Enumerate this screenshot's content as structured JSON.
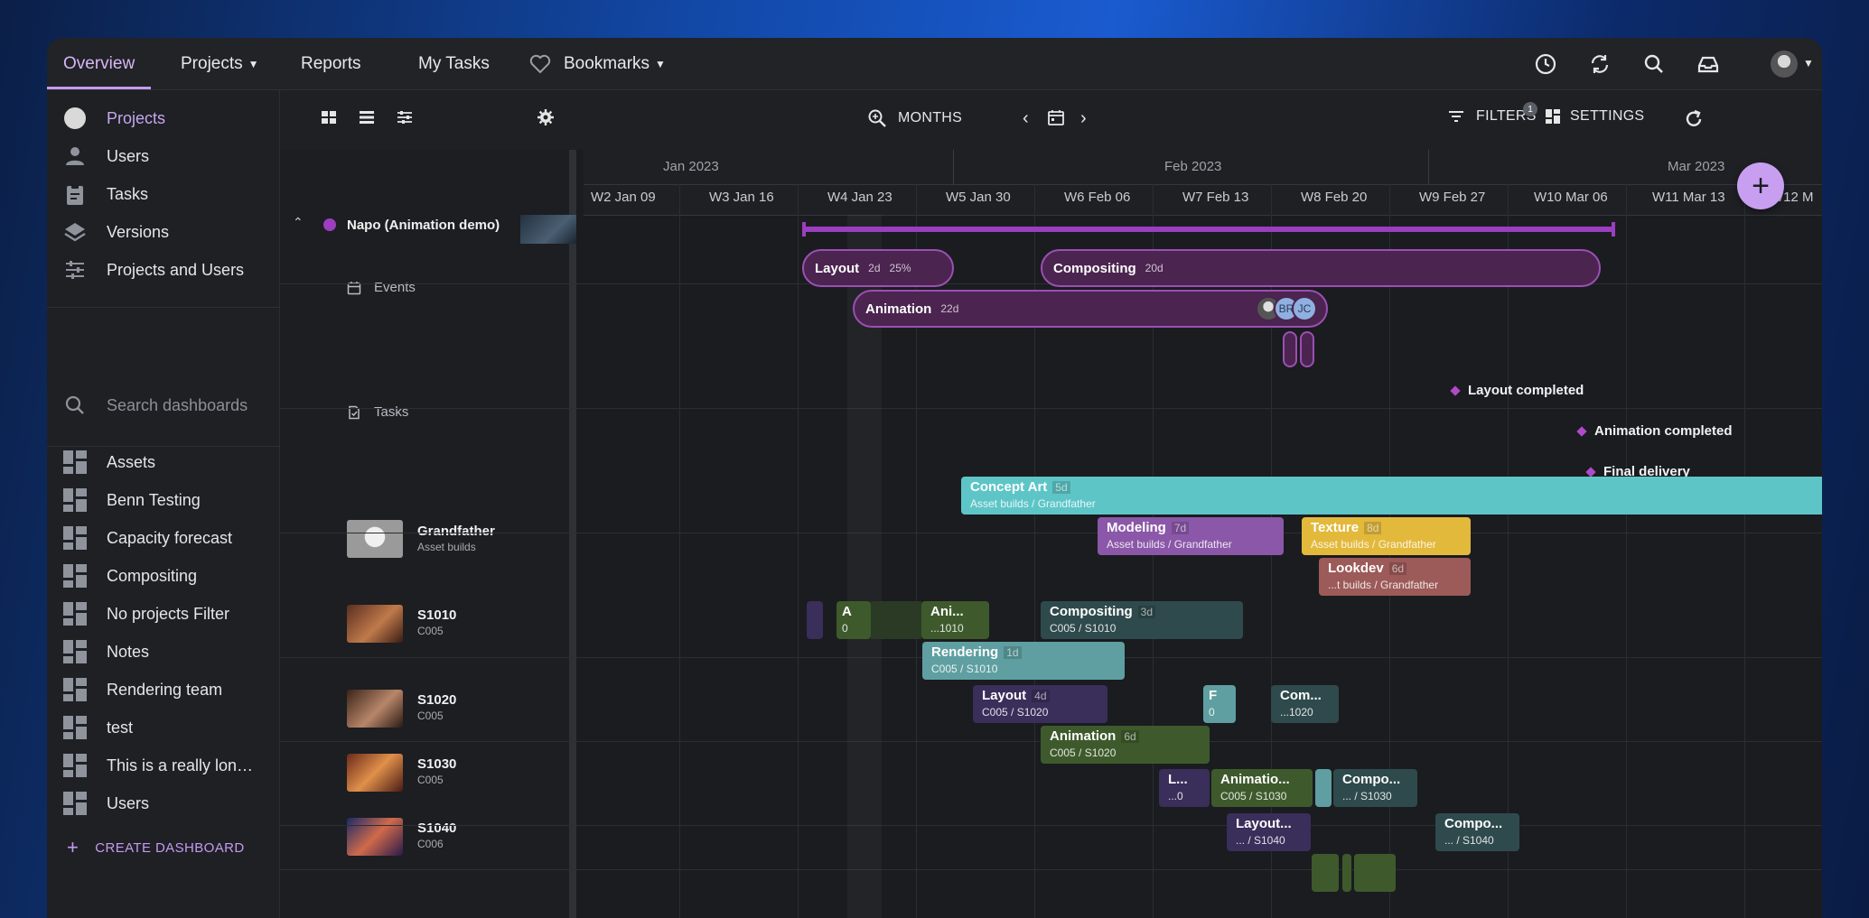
{
  "nav": {
    "overview": "Overview",
    "projects": "Projects",
    "reports": "Reports",
    "my_tasks": "My Tasks",
    "bookmarks": "Bookmarks"
  },
  "sidebar": {
    "items": [
      {
        "label": "Projects"
      },
      {
        "label": "Users"
      },
      {
        "label": "Tasks"
      },
      {
        "label": "Versions"
      },
      {
        "label": "Projects and Users"
      }
    ],
    "search_placeholder": "Search dashboards",
    "dashboards": [
      "Assets",
      "Benn Testing",
      "Capacity forecast",
      "Compositing",
      "No projects Filter",
      "Notes",
      "Rendering team",
      "test",
      "This is a really lon…",
      "Users"
    ],
    "create_label": "CREATE DASHBOARD"
  },
  "toolbar": {
    "zoom_label": "MONTHS",
    "filters_label": "FILTERS",
    "filters_count": "1",
    "settings_label": "SETTINGS"
  },
  "timeline": {
    "months": [
      "Jan 2023",
      "Feb 2023",
      "Mar 2023"
    ],
    "weeks": [
      "W2 Jan 09",
      "W3 Jan 16",
      "W4 Jan 23",
      "W5 Jan 30",
      "W6 Feb 06",
      "W7 Feb 13",
      "W8 Feb 20",
      "W9 Feb 27",
      "W10 Mar 06",
      "W11 Mar 13",
      "W12 M"
    ]
  },
  "rows": {
    "project": "Napo (Animation demo)",
    "events": "Events",
    "tasks": "Tasks",
    "grandfather": {
      "title": "Grandfather",
      "sub": "Asset builds"
    },
    "s1010": {
      "title": "S1010",
      "sub": "C005"
    },
    "s1020": {
      "title": "S1020",
      "sub": "C005"
    },
    "s1030": {
      "title": "S1030",
      "sub": "C005"
    },
    "s1040": {
      "title": "S1040",
      "sub": "C006"
    }
  },
  "events": {
    "layout": {
      "title": "Layout",
      "dur": "2d",
      "pct": "25%"
    },
    "compositing": {
      "title": "Compositing",
      "dur": "20d"
    },
    "animation": {
      "title": "Animation",
      "dur": "22d",
      "avatars": [
        "BR",
        "JC"
      ]
    }
  },
  "milestones": [
    "Layout completed",
    "Animation completed",
    "Final delivery"
  ],
  "bars": {
    "concept_art": {
      "t": "Concept Art",
      "d": "5d",
      "s": "Asset builds / Grandfather"
    },
    "modeling": {
      "t": "Modeling",
      "d": "7d",
      "s": "Asset builds / Grandfather"
    },
    "texture": {
      "t": "Texture",
      "d": "8d",
      "s": "Asset builds / Grandfather"
    },
    "lookdev": {
      "t": "Lookdev",
      "d": "6d",
      "s": "...t builds / Grandfather"
    },
    "s1010_a": {
      "t": "A",
      "s": "0"
    },
    "s1010_ani": {
      "t": "Ani...",
      "s": "...1010"
    },
    "s1010_comp": {
      "t": "Compositing",
      "d": "3d",
      "s": "C005 / S1010"
    },
    "s1010_render": {
      "t": "Rendering",
      "d": "1d",
      "s": "C005 / S1010"
    },
    "s1020_layout": {
      "t": "Layout",
      "d": "4d",
      "s": "C005 / S1020"
    },
    "s1020_f": {
      "t": "F",
      "s": "0"
    },
    "s1020_com": {
      "t": "Com...",
      "s": "...1020"
    },
    "s1020_anim": {
      "t": "Animation",
      "d": "6d",
      "s": "C005 / S1020"
    },
    "s1030_l": {
      "t": "L...",
      "s": "...0"
    },
    "s1030_anim": {
      "t": "Animatio...",
      "s": "C005 / S1030"
    },
    "s1030_comp": {
      "t": "Compo...",
      "s": "... / S1030"
    },
    "s1040_layout": {
      "t": "Layout...",
      "s": "... / S1040"
    },
    "s1040_comp": {
      "t": "Compo...",
      "s": "... / S1040"
    }
  },
  "colors": {
    "accent": "#c49bf0",
    "concept_art": "#5ec5c7",
    "modeling": "#8b57a8",
    "texture": "#e3b93c",
    "lookdev": "#9c5a58",
    "compositing": "#2f4a4c",
    "animation": "#3e5a2c",
    "layout": "#3a2e5a",
    "rendering": "#5f9fa1"
  }
}
